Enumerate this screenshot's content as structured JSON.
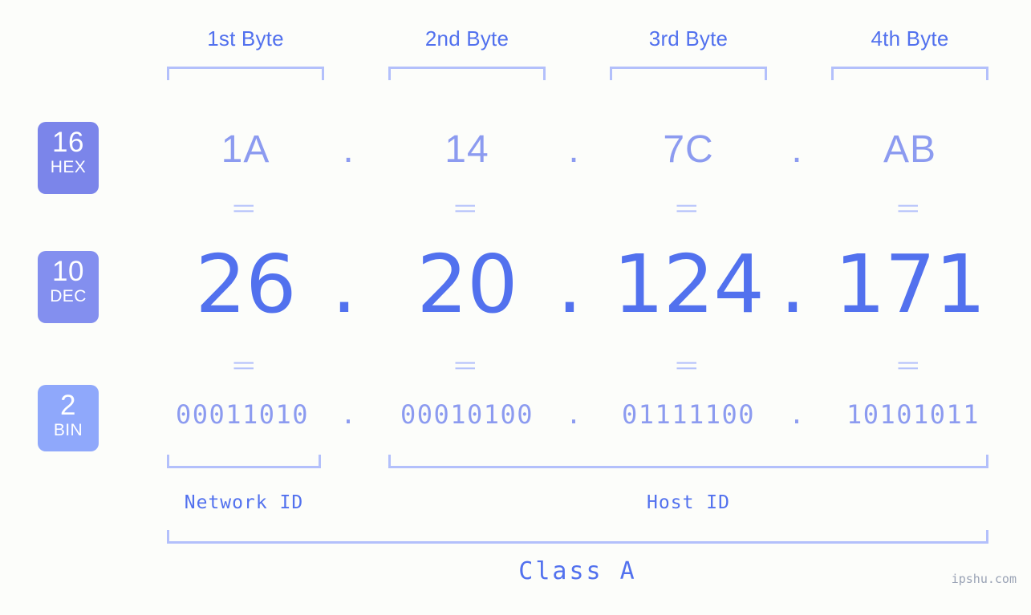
{
  "meta": {
    "background_color": "#fcfdfa",
    "accent_primary": "#5271ee",
    "accent_light": "#8c9bf0",
    "accent_bracket": "#b3c0fb",
    "badge_hex_color": "#7b85ea",
    "badge_dec_color": "#838fef",
    "badge_bin_color": "#8fa8fb"
  },
  "byte_headers": [
    {
      "label": "1st Byte"
    },
    {
      "label": "2nd Byte"
    },
    {
      "label": "3rd Byte"
    },
    {
      "label": "4th Byte"
    }
  ],
  "bases": [
    {
      "number": "16",
      "name": "HEX"
    },
    {
      "number": "10",
      "name": "DEC"
    },
    {
      "number": "2",
      "name": "BIN"
    }
  ],
  "rows": {
    "hex": {
      "base_number": "16",
      "base_name": "HEX",
      "values": [
        "1A",
        "14",
        "7C",
        "AB"
      ],
      "separator": "."
    },
    "dec": {
      "base_number": "10",
      "base_name": "DEC",
      "values": [
        "26",
        "20",
        "124",
        "171"
      ],
      "separator": "."
    },
    "bin": {
      "base_number": "2",
      "base_name": "BIN",
      "values": [
        "00011010",
        "00010100",
        "01111100",
        "10101011"
      ],
      "separator": "."
    }
  },
  "equals_glyph": "||",
  "segments": {
    "network_id": "Network ID",
    "host_id": "Host ID",
    "class": "Class A"
  },
  "watermark": "ipshu.com"
}
